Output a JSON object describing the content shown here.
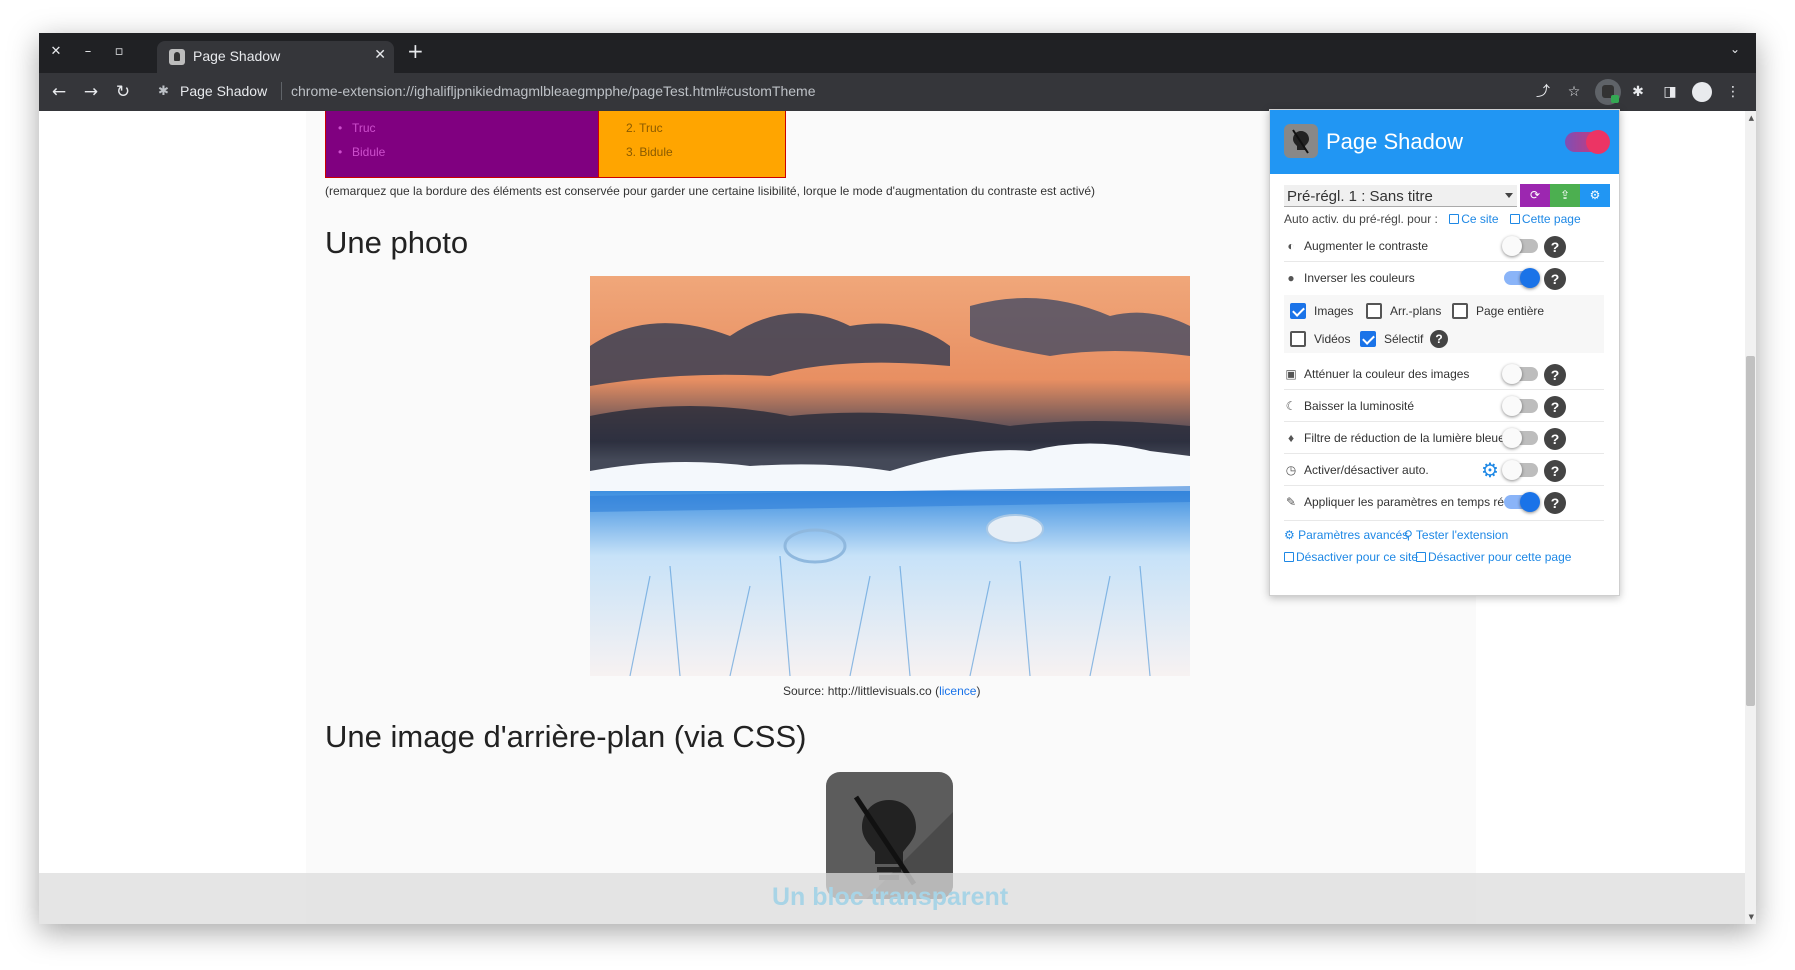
{
  "window_controls": {
    "close": "✕",
    "minimize": "–",
    "maximize": "▫"
  },
  "tab": {
    "title": "Page Shadow",
    "close": "✕"
  },
  "new_tab": "+",
  "tab_menu": "⌄",
  "toolbar": {
    "back": "←",
    "forward": "→",
    "reload": "↻",
    "site_name": "Page Shadow",
    "url": "chrome-extension://ighalifljpnikiedmagmlbleaegmpphe/pageTest.html#customTheme",
    "share": "⤴",
    "star": "☆",
    "puzzle": "✱",
    "sidepanel": "◨",
    "menu": "⋮"
  },
  "page": {
    "list_ul": [
      "Truc",
      "Bidule"
    ],
    "list_ol": [
      "2. Truc",
      "3. Bidule"
    ],
    "note": "(remarquez que la bordure des éléments est conservée pour garder une certaine lisibilité, lorque le mode d'augmentation du contraste est activé)",
    "heading_photo": "Une photo",
    "caption_prefix": "Source: http://littlevisuals.co (",
    "caption_link": "licence",
    "caption_suffix": ")",
    "heading_bg": "Une image d'arrière-plan (via CSS)",
    "transparent_block": "Un bloc transparent"
  },
  "popup": {
    "title": "Page Shadow",
    "main_enabled": true,
    "preset": "Pré-régl. 1 : Sans titre",
    "preset_buttons": {
      "refresh": "⟳",
      "upload": "⇪",
      "settings": "⚙"
    },
    "auto_activation_label": "Auto activ. du pré-régl. pour :",
    "auto_site": "Ce site",
    "auto_page": "Cette page",
    "options": [
      {
        "icon": "◐",
        "label": "Augmenter le contraste",
        "on": false
      },
      {
        "icon": "●",
        "label": "Inverser les couleurs",
        "on": true
      }
    ],
    "invert_sub": [
      {
        "label": "Images",
        "checked": true
      },
      {
        "label": "Arr.-plans",
        "checked": false
      },
      {
        "label": "Page entière",
        "checked": false
      },
      {
        "label": "Vidéos",
        "checked": false
      },
      {
        "label": "Sélectif",
        "checked": true
      }
    ],
    "options2": [
      {
        "icon": "▣",
        "label": "Atténuer la couleur des images",
        "on": false
      },
      {
        "icon": "☾",
        "label": "Baisser la luminosité",
        "on": false
      },
      {
        "icon": "♦",
        "label": "Filtre de réduction de la lumière bleue",
        "on": false
      },
      {
        "icon": "◷",
        "label": "Activer/désactiver auto.",
        "on": false
      },
      {
        "icon": "✎",
        "label": "Appliquer les paramètres en temps réel",
        "on": true
      }
    ],
    "help": "?",
    "footer": {
      "advanced": "Paramètres avancés",
      "test": "Tester l'extension",
      "disable_site": "Désactiver pour ce site",
      "disable_page": "Désactiver pour cette page"
    },
    "colors": {
      "header": "#2196f3",
      "refresh_btn": "#9c27b0",
      "upload_btn": "#4caf50",
      "settings_btn": "#2196f3"
    }
  }
}
